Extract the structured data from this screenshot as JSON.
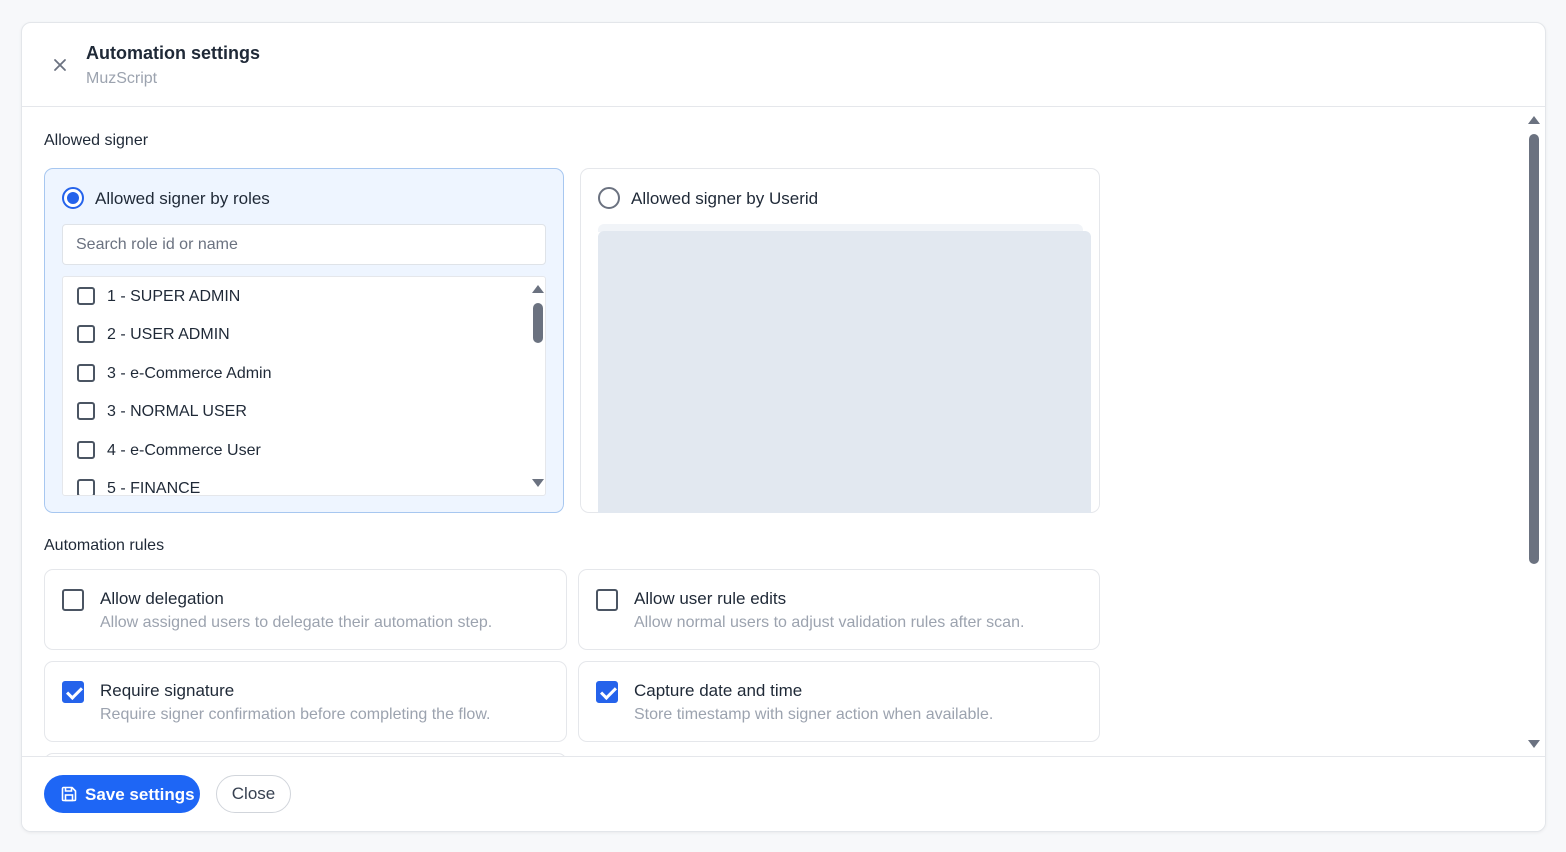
{
  "header": {
    "title": "Automation settings",
    "subtitle": "MuzScript"
  },
  "allowed_signer": {
    "section_label": "Allowed signer",
    "by_roles": {
      "label": "Allowed signer by roles",
      "selected": true,
      "search_placeholder": "Search role id or name",
      "roles": [
        {
          "label": "1 - SUPER ADMIN",
          "checked": false
        },
        {
          "label": "2 - USER ADMIN",
          "checked": false
        },
        {
          "label": "3 - e-Commerce Admin",
          "checked": false
        },
        {
          "label": "3 - NORMAL USER",
          "checked": false
        },
        {
          "label": "4 - e-Commerce User",
          "checked": false
        },
        {
          "label": "5 - FINANCE",
          "checked": false
        }
      ]
    },
    "by_userid": {
      "label": "Allowed signer by Userid",
      "selected": false
    }
  },
  "automation_rules": {
    "section_label": "Automation rules",
    "rules": [
      {
        "title": "Allow delegation",
        "description": "Allow assigned users to delegate their automation step.",
        "checked": false
      },
      {
        "title": "Allow user rule edits",
        "description": "Allow normal users to adjust validation rules after scan.",
        "checked": false
      },
      {
        "title": "Require signature",
        "description": "Require signer confirmation before completing the flow.",
        "checked": true
      },
      {
        "title": "Capture date and time",
        "description": "Store timestamp with signer action when available.",
        "checked": true
      }
    ]
  },
  "footer": {
    "save_label": "Save settings",
    "close_label": "Close"
  },
  "colors": {
    "accent": "#1e66f5",
    "active_card_bg": "#eef5ff",
    "placeholder_panel": "#e2e8f0"
  },
  "icons": {
    "close": "close-icon",
    "save": "save-icon",
    "scroll_up": "triangle-up-icon",
    "scroll_down": "triangle-down-icon"
  }
}
